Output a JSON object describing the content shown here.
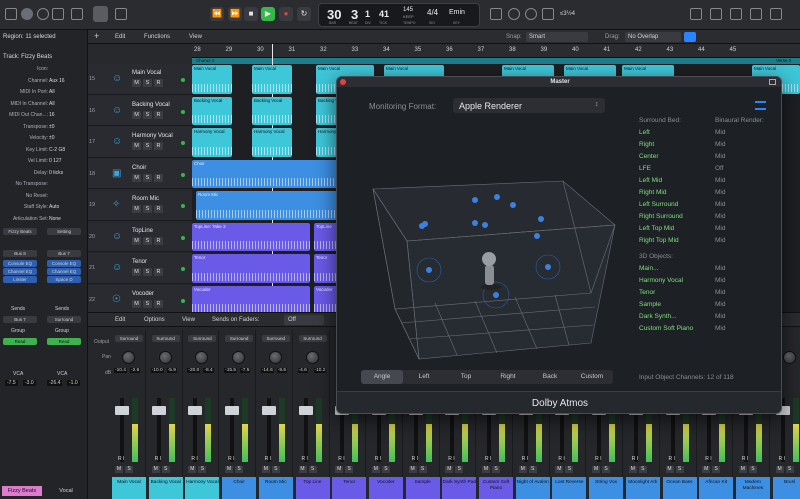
{
  "toolbar": {
    "lcd": {
      "bar": "30",
      "beat": "3",
      "div": "1",
      "tick": "41",
      "tempo": "145",
      "tempo_sub": "KEEP",
      "sig": "4/4",
      "key": "Emin",
      "bar_lbl": "BAR",
      "beat_lbl": "BEAT",
      "div_lbl": "DIV",
      "tick_lbl": "TICK",
      "tempo_lbl": "TEMPO",
      "key_lbl": "KEY",
      "sig_lbl": "SIG"
    },
    "counter": "≤3½4"
  },
  "region_header": "Region: 11 selected",
  "track_header": "Track: Fizzy Beats",
  "submenu": {
    "edit": "Edit",
    "functions": "Functions",
    "view": "View",
    "snap_label": "Snap:",
    "snap_value": "Smart",
    "drag_label": "Drag:",
    "drag_value": "No Overlap"
  },
  "inspector": [
    {
      "k": "Icon:",
      "v": ""
    },
    {
      "k": "Channel:",
      "v": "Aux 16"
    },
    {
      "k": "MIDI In Port:",
      "v": "All"
    },
    {
      "k": "MIDI In Channel:",
      "v": "All"
    },
    {
      "k": "MIDI Out Chan...:",
      "v": "16"
    },
    {
      "k": "Transpose:",
      "v": "±0"
    },
    {
      "k": "Velocity:",
      "v": "±0"
    },
    {
      "k": "Key Limit:",
      "v": "C-2  G8"
    },
    {
      "k": "Vel Limit:",
      "v": "0  127"
    },
    {
      "k": "Delay:",
      "v": "0 ticks"
    },
    {
      "k": "No Transpose:",
      "v": ""
    },
    {
      "k": "No Reset:",
      "v": ""
    },
    {
      "k": "Staff Style:",
      "v": "Auto"
    },
    {
      "k": "Articulation Set:",
      "v": "None"
    }
  ],
  "left_strips": [
    {
      "name": "Fizzy Beats",
      "setting": "Setting",
      "io": "Bus 8",
      "eq": [
        "Console EQ",
        "Channel EQ",
        "Limiter"
      ],
      "sends": "Sends",
      "bus": "Bus 7",
      "group": "Group",
      "auto": "Read",
      "vca": "VCA",
      "vals": [
        "-7.5",
        "-3.0"
      ]
    },
    {
      "name": "Vocal",
      "setting": "Setting",
      "io": "Bus 7",
      "eq": [
        "Console EQ",
        "Channel EQ",
        "Space D"
      ],
      "sends": "Sends",
      "bus": "Surround",
      "group": "Group",
      "auto": "Read",
      "vca": "VCA",
      "vals": [
        "-26.4",
        "-1.0"
      ]
    }
  ],
  "ruler": {
    "marks": [
      "28",
      "29",
      "30",
      "31",
      "32",
      "33",
      "34",
      "35",
      "36",
      "37",
      "38",
      "39",
      "40",
      "41",
      "42",
      "43",
      "44",
      "45"
    ],
    "markers": {
      "chorus": "Chorus 1",
      "verse": "Verse 2"
    }
  },
  "tracks": [
    {
      "num": "15",
      "name": "Main Vocal",
      "icon": "☺",
      "regions": [
        {
          "label": "Main Vocal"
        },
        {
          "label": "Main Vocal"
        },
        {
          "label": "Main Vocal"
        },
        {
          "label": "Main Vocal"
        },
        {
          "label": "Main Vocal"
        },
        {
          "label": "Main Vocal"
        },
        {
          "label": "Main Vocal"
        },
        {
          "label": "Main Vocal"
        }
      ]
    },
    {
      "num": "16",
      "name": "Backing Vocal",
      "icon": "☺",
      "regions": [
        {
          "label": "Backing Vocal"
        },
        {
          "label": "Backing Vocal"
        },
        {
          "label": "Backing Vocal"
        }
      ]
    },
    {
      "num": "17",
      "name": "Harmony Vocal",
      "icon": "☺",
      "regions": [
        {
          "label": "Harmony Vocal"
        },
        {
          "label": "Harmony Vocal"
        },
        {
          "label": "Harmony Vocal"
        }
      ]
    },
    {
      "num": "18",
      "name": "Choir",
      "icon": "▣",
      "regions": [
        {
          "label": "Choir"
        }
      ]
    },
    {
      "num": "19",
      "name": "Room Mic",
      "icon": "✧",
      "regions": [
        {
          "label": "Room Mic"
        }
      ]
    },
    {
      "num": "20",
      "name": "TopLine",
      "icon": "☺",
      "regions": [
        {
          "label": "TopLine: Take 3"
        },
        {
          "label": "TopLine"
        }
      ]
    },
    {
      "num": "21",
      "name": "Tenor",
      "icon": "☺",
      "regions": [
        {
          "label": "Tenor"
        },
        {
          "label": "Tenor"
        }
      ]
    },
    {
      "num": "22",
      "name": "Vocoder",
      "icon": "☉",
      "regions": [
        {
          "label": "Vocoder"
        },
        {
          "label": "Vocoder"
        }
      ]
    }
  ],
  "mixer_bar": {
    "edit": "Edit",
    "options": "Options",
    "view": "View",
    "sends_on_faders": "Sends on Faders:",
    "off": "Off"
  },
  "mixer_labels": {
    "output": "Output",
    "pan": "Pan",
    "db": "dB",
    "ri": "R I",
    "m": "M",
    "s": "S"
  },
  "mixer_strips": [
    {
      "name": "Main Vocal",
      "out": "Surround",
      "v1": "-10.4",
      "v2": "-2.6",
      "color": "#3ec6d9"
    },
    {
      "name": "Backing Vocal",
      "out": "Surround",
      "v1": "-10.0",
      "v2": "-5.9",
      "color": "#3ec6d9"
    },
    {
      "name": "Harmony Vocal",
      "out": "Surround",
      "v1": "-20.0",
      "v2": "-8.4",
      "color": "#3ec6d9"
    },
    {
      "name": "Choir",
      "out": "Surround",
      "v1": "-15.5",
      "v2": "-7.5",
      "color": "#3d8fe3"
    },
    {
      "name": "Room Mic",
      "out": "Surround",
      "v1": "-14.6",
      "v2": "-9.6",
      "color": "#3d8fe3"
    },
    {
      "name": "Top Line",
      "out": "Surround",
      "v1": "-4.6",
      "v2": "-10.2",
      "color": "#6a5ae8"
    },
    {
      "name": "Tenor",
      "out": "",
      "v1": "",
      "v2": "",
      "color": "#6a5ae8"
    },
    {
      "name": "Vocoder",
      "out": "",
      "v1": "",
      "v2": "",
      "color": "#6a5ae8"
    },
    {
      "name": "Sample",
      "out": "",
      "v1": "",
      "v2": "",
      "color": "#6a5ae8"
    },
    {
      "name": "Dark Synth Pad",
      "out": "",
      "v1": "",
      "v2": "",
      "color": "#6a5ae8"
    },
    {
      "name": "Custom Soft Piano",
      "out": "",
      "v1": "",
      "v2": "",
      "color": "#6a5ae8"
    },
    {
      "name": "Night of Avalon",
      "out": "",
      "v1": "",
      "v2": "",
      "color": "#3d8fe3"
    },
    {
      "name": "Lost Reverse",
      "out": "",
      "v1": "",
      "v2": "",
      "color": "#3d8fe3"
    },
    {
      "name": "String Vox",
      "out": "",
      "v1": "",
      "v2": "",
      "color": "#3d8fe3"
    },
    {
      "name": "Moonlight Ark",
      "out": "",
      "v1": "",
      "v2": "",
      "color": "#3d8fe3"
    },
    {
      "name": "Ocean Bass",
      "out": "",
      "v1": "",
      "v2": "",
      "color": "#3d8fe3"
    },
    {
      "name": "African Kit",
      "out": "",
      "v1": "",
      "v2": "",
      "color": "#3d8fe3"
    },
    {
      "name": "Modern Machines",
      "out": "",
      "v1": "",
      "v2": "",
      "color": "#3d8fe3"
    },
    {
      "name": "Brusl",
      "out": "",
      "v1": "",
      "v2": "",
      "color": "#3d8fe3"
    }
  ],
  "master": {
    "title": "Master",
    "monitoring_label": "Monitoring Format:",
    "monitoring_value": "Apple Renderer",
    "surround_bed_header": "Surround Bed:",
    "binaural_header": "Binaural Render:",
    "bed": [
      {
        "name": "Left",
        "mode": "Mid"
      },
      {
        "name": "Right",
        "mode": "Mid"
      },
      {
        "name": "Center",
        "mode": "Mid"
      },
      {
        "name": "LFE",
        "mode": "Off"
      },
      {
        "name": "Left Mid",
        "mode": "Mid"
      },
      {
        "name": "Right Mid",
        "mode": "Mid"
      },
      {
        "name": "Left Surround",
        "mode": "Mid"
      },
      {
        "name": "Right Surround",
        "mode": "Mid"
      },
      {
        "name": "Left Top Mid",
        "mode": "Mid"
      },
      {
        "name": "Right Top Mid",
        "mode": "Mid"
      }
    ],
    "objects_header": "3D Objects:",
    "objects": [
      {
        "name": "Main...",
        "mode": "Mid"
      },
      {
        "name": "Harmony Vocal",
        "mode": "Mid"
      },
      {
        "name": "Tenor",
        "mode": "Mid"
      },
      {
        "name": "Sample",
        "mode": "Mid"
      },
      {
        "name": "Dark Synth...",
        "mode": "Mid"
      },
      {
        "name": "Custom Soft Piano",
        "mode": "Mid"
      }
    ],
    "views": [
      "Angle",
      "Left",
      "Top",
      "Right",
      "Back",
      "Custom"
    ],
    "active_view": "Angle",
    "input_channels": "Input Object Channels: 12 of 118",
    "footer": "Dolby Atmos"
  },
  "colors": {
    "cyan": "#3ec6d9",
    "blue": "#3d8fe3",
    "purple": "#6a5ae8",
    "green_text": "#7fe07f",
    "accent": "#2a84ff",
    "play": "#35b84a",
    "record": "#e0443a"
  }
}
